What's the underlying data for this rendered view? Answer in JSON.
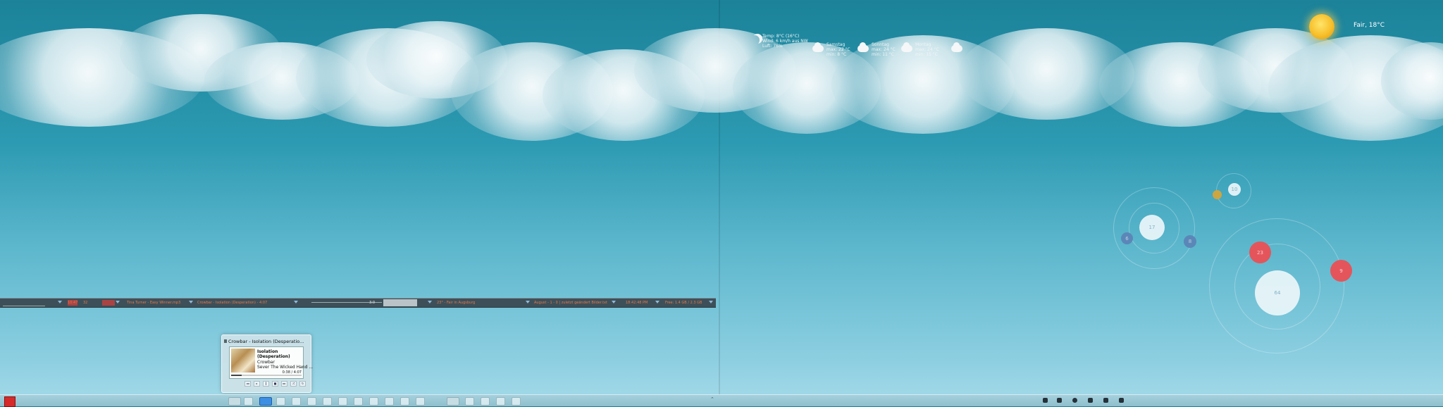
{
  "desktop": {
    "weather_current": {
      "icon": "moon-icon",
      "line1": "Temp: 8°C (16°C)",
      "line2": "Wind: 6 km/h aus NW",
      "line3": "Luft: 76%"
    },
    "forecast": [
      {
        "day": "Samstag",
        "max": "max: 22 °C",
        "min": "min: 8 °C",
        "icon": "partly-cloudy-icon"
      },
      {
        "day": "Sonntag",
        "max": "max: 24 °C",
        "min": "min: 11 °C",
        "icon": "partly-cloudy-icon"
      },
      {
        "day": "Montag",
        "max": "max: 24 °C",
        "min": "min: 15 °C",
        "icon": "rain-icon"
      },
      {
        "day": "",
        "max": "",
        "min": "",
        "icon": "cloud-icon"
      }
    ],
    "sun_widget": {
      "label": "Fair, 18°C",
      "icon": "sun-icon"
    },
    "bubbles": {
      "a": "17",
      "b": "6",
      "c": "8",
      "d": "10",
      "e": "",
      "f": "23",
      "g": "9",
      "h": "64"
    }
  },
  "taskstrip": {
    "segments": [
      "  ",
      "10:47",
      "32",
      "Tina Turner - Easy Winner.mp3",
      "Crowbar - Isolation (Desperation) - 4:07",
      "Crowbar",
      "3:0",
      "23° - Fair in Augsburg",
      "August - 1 - 0 | zuletzt geändert Bilder.txt",
      "18:42:48 PM",
      "Free: 1.4 GB / 2.3 GB"
    ]
  },
  "popup": {
    "title": "Crowbar - Isolation (Desperatio...",
    "track": "Isolation",
    "album": "(Desperation)",
    "artist": "Crowbar",
    "extra": "Sever The Wicked Hand ...",
    "time": "0:38 / 4:07",
    "progress": 0.15,
    "controls": [
      "prev-icon",
      "play-icon",
      "pause-icon",
      "stop-icon",
      "next-icon",
      "shuffle-icon",
      "repeat-icon"
    ]
  },
  "taskbar": {
    "icons": [
      "firefox-icon",
      "folder-icon",
      "media-player-icon",
      "calendar-icon",
      "settings-icon",
      "music-icon",
      "mail-icon",
      "chat-icon",
      "network-icon",
      "terminal-icon",
      "document-icon",
      "image-icon",
      "download-icon",
      "window-icon",
      "window-icon",
      "window-icon",
      "window-icon",
      "window-icon"
    ],
    "tray": [
      "shield-icon",
      "rss-icon",
      "globe-icon",
      "network-icon",
      "usb-icon",
      "volume-icon"
    ]
  }
}
